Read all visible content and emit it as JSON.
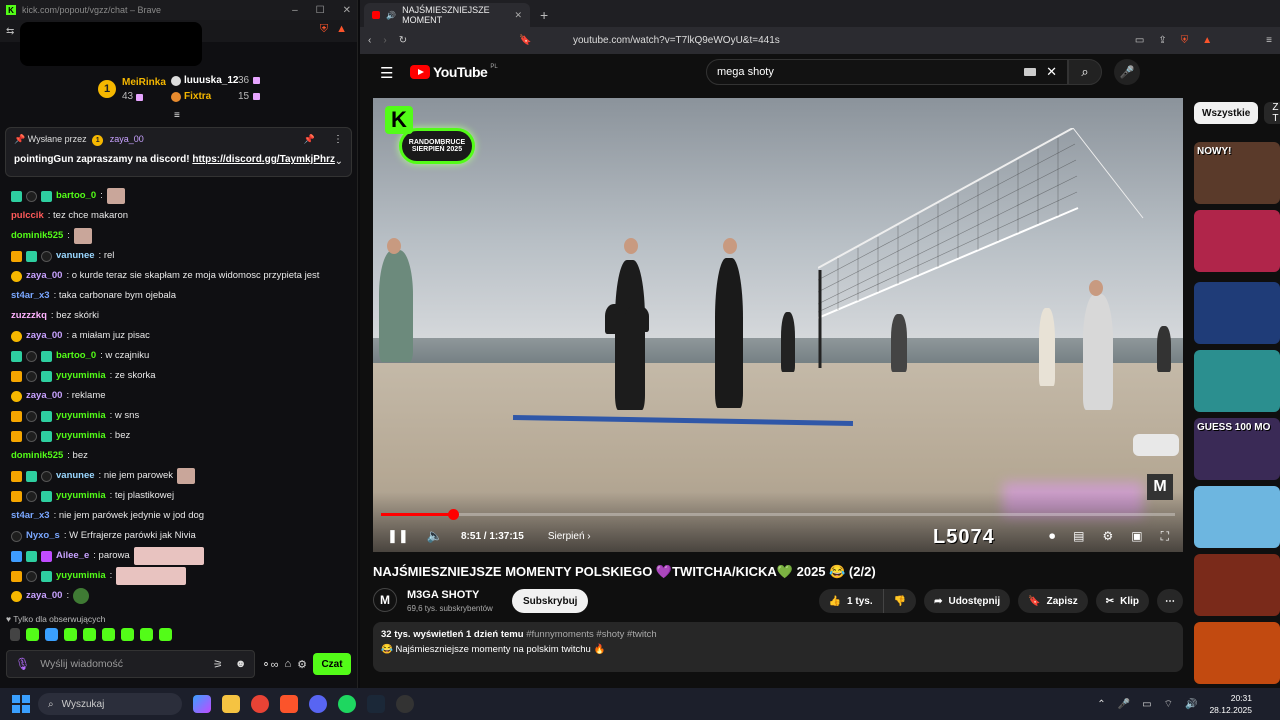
{
  "chat_window": {
    "titlebar_text": "kick.com/popout/vgzz/chat – Brave",
    "top_gifters": [
      {
        "name": "MeiRinka",
        "count": "43",
        "color": "#f5b700"
      },
      {
        "name": "luuuska_12",
        "count": "36",
        "color": "#ffffff"
      },
      {
        "name": "Fixtra",
        "count": "15",
        "color": "#f5b700"
      }
    ],
    "pinned": {
      "label": "Wysłane przez",
      "user": "zaya_00",
      "message": "pointingGun zapraszamy na discord! ",
      "link": "https://discord.gg/TaymkjPhrz"
    },
    "messages": [
      {
        "user": "bartoo_0",
        "text": ":",
        "color": "#53fc18",
        "badges": [
          "og",
          "sub",
          "og"
        ],
        "emote": "pic"
      },
      {
        "user": "pulccik",
        "text": ": tez chce makaron",
        "color": "#ff5a5a",
        "badges": []
      },
      {
        "user": "dominik525",
        "text": ":",
        "color": "#53fc18",
        "badges": [],
        "emote": "pic"
      },
      {
        "user": "vanunee",
        "text": ": rel",
        "color": "#9ad7ff",
        "badges": [
          "crown",
          "og",
          "sub"
        ]
      },
      {
        "user": "zaya_00",
        "text": ": o kurde teraz sie skapłam ze moja widomosc przypieta jest",
        "color": "#c8a2ff",
        "badges": [
          "coin"
        ]
      },
      {
        "user": "st4ar_x3",
        "text": ": taka carbonare bym ojebala",
        "color": "#7aa7ff",
        "badges": []
      },
      {
        "user": "zuzzzkq",
        "text": ": bez skórki",
        "color": "#ffb3ff",
        "badges": []
      },
      {
        "user": "zaya_00",
        "text": ": a miałam juz pisac",
        "color": "#c8a2ff",
        "badges": [
          "coin"
        ]
      },
      {
        "user": "bartoo_0",
        "text": ": w czajniku",
        "color": "#53fc18",
        "badges": [
          "og",
          "sub",
          "og"
        ]
      },
      {
        "user": "yuyumimia",
        "text": ": ze skorka",
        "color": "#53fc18",
        "badges": [
          "crown",
          "sub",
          "og"
        ]
      },
      {
        "user": "zaya_00",
        "text": ": reklame",
        "color": "#c8a2ff",
        "badges": [
          "coin"
        ]
      },
      {
        "user": "yuyumimia",
        "text": ": w sns",
        "color": "#53fc18",
        "badges": [
          "crown",
          "sub",
          "og"
        ]
      },
      {
        "user": "yuyumimia",
        "text": ": bez",
        "color": "#53fc18",
        "badges": [
          "crown",
          "sub",
          "og"
        ]
      },
      {
        "user": "dominik525",
        "text": ": bez",
        "color": "#53fc18",
        "badges": []
      },
      {
        "user": "vanunee",
        "text": ": nie jem parowek",
        "color": "#9ad7ff",
        "badges": [
          "crown",
          "og",
          "sub"
        ],
        "emote": "pic"
      },
      {
        "user": "yuyumimia",
        "text": ": tej plastikowej",
        "color": "#53fc18",
        "badges": [
          "crown",
          "sub",
          "og"
        ]
      },
      {
        "user": "st4ar_x3",
        "text": ": nie jem parówek jedynie w jod dog",
        "color": "#7aa7ff",
        "badges": []
      },
      {
        "user": "Nyxo_s",
        "text": ": W Erfrajerze parówki jak Nivia",
        "color": "#7aa7ff",
        "badges": [
          "sub"
        ]
      },
      {
        "user": "Ailee_e",
        "text": ": parowa",
        "color": "#c8a2ff",
        "badges": [
          "fly",
          "og",
          "vip"
        ],
        "emote": "wide"
      },
      {
        "user": "yuyumimia",
        "text": ":",
        "color": "#53fc18",
        "badges": [
          "crown",
          "sub",
          "og"
        ],
        "emote": "wide"
      },
      {
        "user": "zaya_00",
        "text": ":",
        "color": "#c8a2ff",
        "badges": [
          "coin"
        ],
        "emote": "green"
      }
    ],
    "followers_only": "Tylko dla obserwujących",
    "input_placeholder": "Wyślij wiadomość",
    "send_label": "Czat"
  },
  "browser": {
    "tab_title": "NAJŚMIESZNIEJSZE MOMENT",
    "url": "youtube.com/watch?v=T7lkQ9eWOyU&t=441s"
  },
  "youtube": {
    "logo_text": "YouTube",
    "logo_region": "PL",
    "search_query": "mega shoty",
    "video": {
      "badge_line1": "RANDOMBRUCE",
      "badge_line2": "SIERPIEŃ 2025",
      "overlay_code": "L5074",
      "watermark": "M",
      "time": "8:51 / 1:37:15",
      "chapter": "Sierpień",
      "progress": 0.091
    },
    "title": "NAJŚMIESZNIEJSZE MOMENTY POLSKIEGO 💜TWITCHA/KICKA💚 2025 😂 (2/2)",
    "channel": {
      "name": "M3GA SHOTY",
      "subs": "69,6 tys. subskrybentów",
      "avatar_letter": "M"
    },
    "subscribe_label": "Subskrybuj",
    "likes": "1 tys.",
    "share_label": "Udostępnij",
    "save_label": "Zapisz",
    "clip_label": "Klip",
    "description": {
      "stats": "32 tys. wyświetleń  1 dzień temu",
      "tags": "#funnymoments #shoty #twitch",
      "line2": "😂 Najśmieszniejsze momenty na polskim twitchu 🔥"
    },
    "chips": [
      "Wszystkie",
      "Z T"
    ],
    "thumbs": [
      {
        "caption": "NOWY!",
        "color": "#5a3a2a"
      },
      {
        "caption": "",
        "color": "#b0254a"
      },
      {
        "caption": "",
        "color": "#1f3c78"
      },
      {
        "caption": "",
        "color": "#2b8f8f"
      },
      {
        "caption": "GUESS 100 MO",
        "color": "#3a2a56"
      },
      {
        "caption": "",
        "color": "#6db6e0"
      },
      {
        "caption": "",
        "color": "#7a2a1a"
      },
      {
        "caption": "",
        "color": "#c24a10"
      }
    ]
  },
  "taskbar": {
    "search_label": "Wyszukaj",
    "time": "20:31",
    "date": "28.12.2025"
  }
}
